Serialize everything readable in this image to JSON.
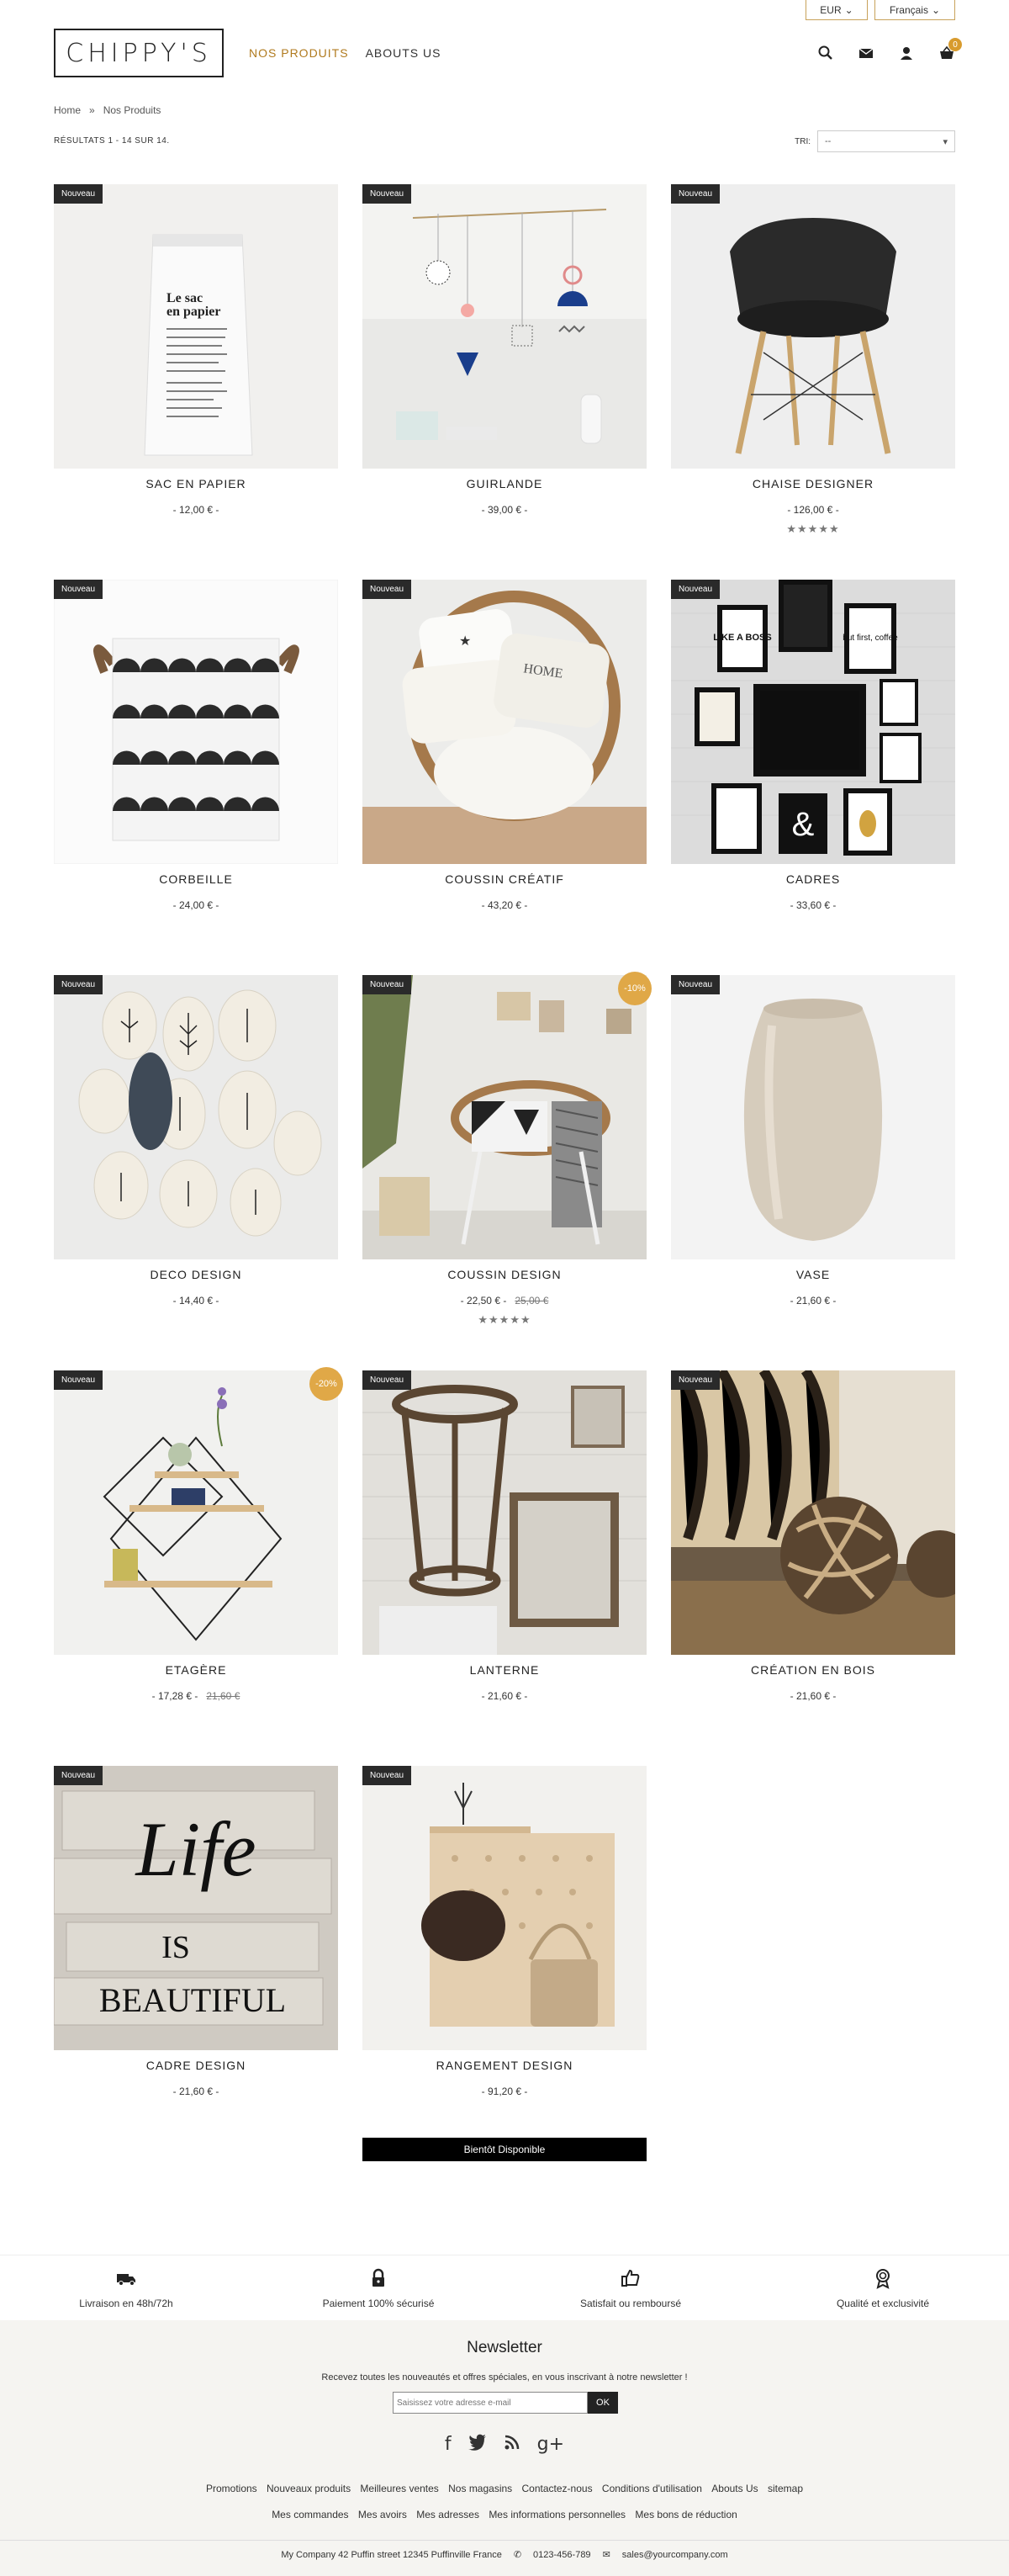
{
  "topbar": {
    "currency": "EUR",
    "language": "Français"
  },
  "header": {
    "logo": "CHIPPY'S",
    "nav": [
      {
        "label": "NOS PRODUITS",
        "active": true
      },
      {
        "label": "ABOUTS US",
        "active": false
      }
    ],
    "cart_count": "0"
  },
  "breadcrumb": {
    "home": "Home",
    "sep": "»",
    "current": "Nos Produits"
  },
  "listing": {
    "results": "RÉSULTATS 1 - 14 SUR 14.",
    "sort_label": "TRI:",
    "sort_value": "--"
  },
  "products": [
    {
      "name": "SAC EN PAPIER",
      "price": "- 12,00 € -",
      "badge": "Nouveau",
      "stars": ""
    },
    {
      "name": "GUIRLANDE",
      "price": "- 39,00 € -",
      "badge": "Nouveau",
      "stars": ""
    },
    {
      "name": "CHAISE DESIGNER",
      "price": "- 126,00 € -",
      "badge": "Nouveau",
      "stars": "★★★★★"
    },
    {
      "name": "CORBEILLE",
      "price": "- 24,00 € -",
      "badge": "Nouveau",
      "stars": ""
    },
    {
      "name": "COUSSIN CRÉATIF",
      "price": "- 43,20 € -",
      "badge": "Nouveau",
      "stars": ""
    },
    {
      "name": "CADRES",
      "price": "- 33,60 € -",
      "badge": "Nouveau",
      "stars": ""
    },
    {
      "name": "DECO DESIGN",
      "price": "- 14,40 € -",
      "badge": "Nouveau",
      "stars": ""
    },
    {
      "name": "COUSSIN DESIGN",
      "price": "- 22,50 € -",
      "old_price": "25,00 €",
      "discount": "-10%",
      "badge": "Nouveau",
      "stars": "★★★★★"
    },
    {
      "name": "VASE",
      "price": "- 21,60 € -",
      "badge": "Nouveau",
      "stars": ""
    },
    {
      "name": "ETAGÈRE",
      "price": "- 17,28 € -",
      "old_price": "21,60 €",
      "discount": "-20%",
      "badge": "Nouveau",
      "stars": ""
    },
    {
      "name": "LANTERNE",
      "price": "- 21,60 € -",
      "badge": "Nouveau",
      "stars": ""
    },
    {
      "name": "CRÉATION EN BOIS",
      "price": "- 21,60 € -",
      "badge": "Nouveau",
      "stars": ""
    },
    {
      "name": "CADRE DESIGN",
      "price": "- 21,60 € -",
      "badge": "Nouveau",
      "stars": ""
    },
    {
      "name": "RANGEMENT DESIGN",
      "price": "- 91,20 € -",
      "badge": "Nouveau",
      "stars": "",
      "availability": "Bientôt Disponible"
    }
  ],
  "product_art": {
    "bag_title_1": "Le sac",
    "bag_title_2": "en papier",
    "frame_boss": "LIKE A BOSS",
    "frame_coffee": "but first, coffee",
    "frame_amp": "&",
    "sign_life": "Life",
    "sign_is": "IS",
    "sign_beautiful": "BEAUTIFUL",
    "cushion_home": "HOME"
  },
  "reassurance": [
    {
      "icon": "truck-icon",
      "label": "Livraison en 48h/72h"
    },
    {
      "icon": "lock-icon",
      "label": "Paiement 100% sécurisé"
    },
    {
      "icon": "thumbs-up-icon",
      "label": "Satisfait ou remboursé"
    },
    {
      "icon": "award-icon",
      "label": "Qualité et exclusivité"
    }
  ],
  "newsletter": {
    "title": "Newsletter",
    "text": "Recevez toutes les nouveautés et offres spéciales, en vous inscrivant à notre newsletter !",
    "placeholder": "Saisissez votre adresse e-mail",
    "button": "OK"
  },
  "footer_links_1": [
    "Promotions",
    "Nouveaux produits",
    "Meilleures ventes",
    "Nos magasins",
    "Contactez-nous",
    "Conditions d'utilisation",
    "Abouts Us",
    "sitemap"
  ],
  "footer_links_2": [
    "Mes commandes",
    "Mes avoirs",
    "Mes adresses",
    "Mes informations personnelles",
    "Mes bons de réduction"
  ],
  "contact": {
    "address": "My Company  42  Puffin street  12345  Puffinville  France",
    "phone": "0123-456-789",
    "email": "sales@yourcompany.com"
  },
  "colors": {
    "accent": "#b07a1e",
    "badge_bg": "#2a2a2a",
    "discount": "#e0a847",
    "footer_bg": "#f5f4f1"
  }
}
